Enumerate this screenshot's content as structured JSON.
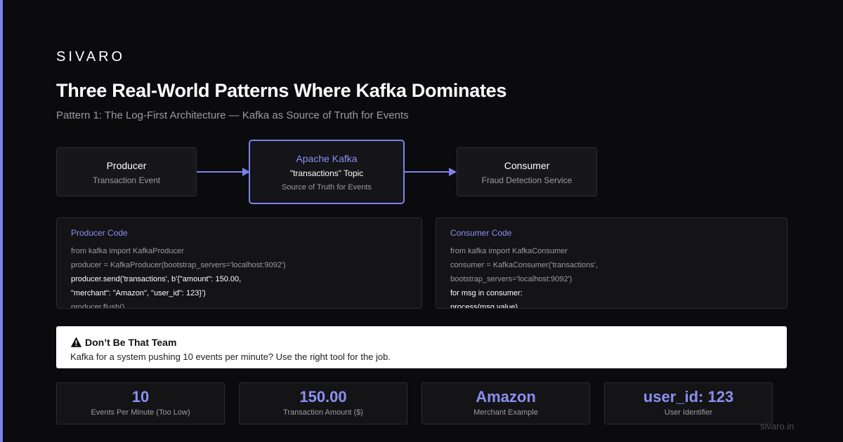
{
  "brand": "SIVARO",
  "title": "Three Real-World Patterns Where Kafka Dominates",
  "subtitle": "Pattern 1: The Log-First Architecture — Kafka as Source of Truth for Events",
  "colors": {
    "accent": "#7b83eb",
    "background": "#0b0b0d",
    "panel": "#17171b"
  },
  "diagram": {
    "producer": {
      "title": "Producer",
      "subtitle": "Transaction Event"
    },
    "kafka": {
      "title": "Apache Kafka",
      "topic": "\"transactions\" Topic",
      "subtitle": "Source of Truth for Events"
    },
    "consumer": {
      "title": "Consumer",
      "subtitle": "Fraud Detection Service"
    }
  },
  "producer_code": {
    "title": "Producer Code",
    "lines": [
      "from kafka import KafkaProducer",
      "producer = KafkaProducer(bootstrap_servers='localhost:9092')",
      "producer.send('transactions', b'{\"amount\": 150.00,",
      "\"merchant\": \"Amazon\", \"user_id\": 123}')",
      "producer.flush()"
    ]
  },
  "consumer_code": {
    "title": "Consumer Code",
    "lines": [
      "from kafka import KafkaConsumer",
      "consumer = KafkaConsumer('transactions',",
      "bootstrap_servers='localhost:9092')",
      "for msg in consumer:",
      "process(msg.value)"
    ]
  },
  "warning": {
    "icon": "warning-icon",
    "heading": "Don’t Be That Team",
    "text": "Kafka for a system pushing 10 events per minute? Use the right tool for the job."
  },
  "stats": [
    {
      "value": "10",
      "label": "Events Per Minute (Too Low)"
    },
    {
      "value": "150.00",
      "label": "Transaction Amount ($)"
    },
    {
      "value": "Amazon",
      "label": "Merchant Example"
    },
    {
      "value": "user_id: 123",
      "label": "User Identifier"
    }
  ],
  "footer_url": "sivaro.in"
}
